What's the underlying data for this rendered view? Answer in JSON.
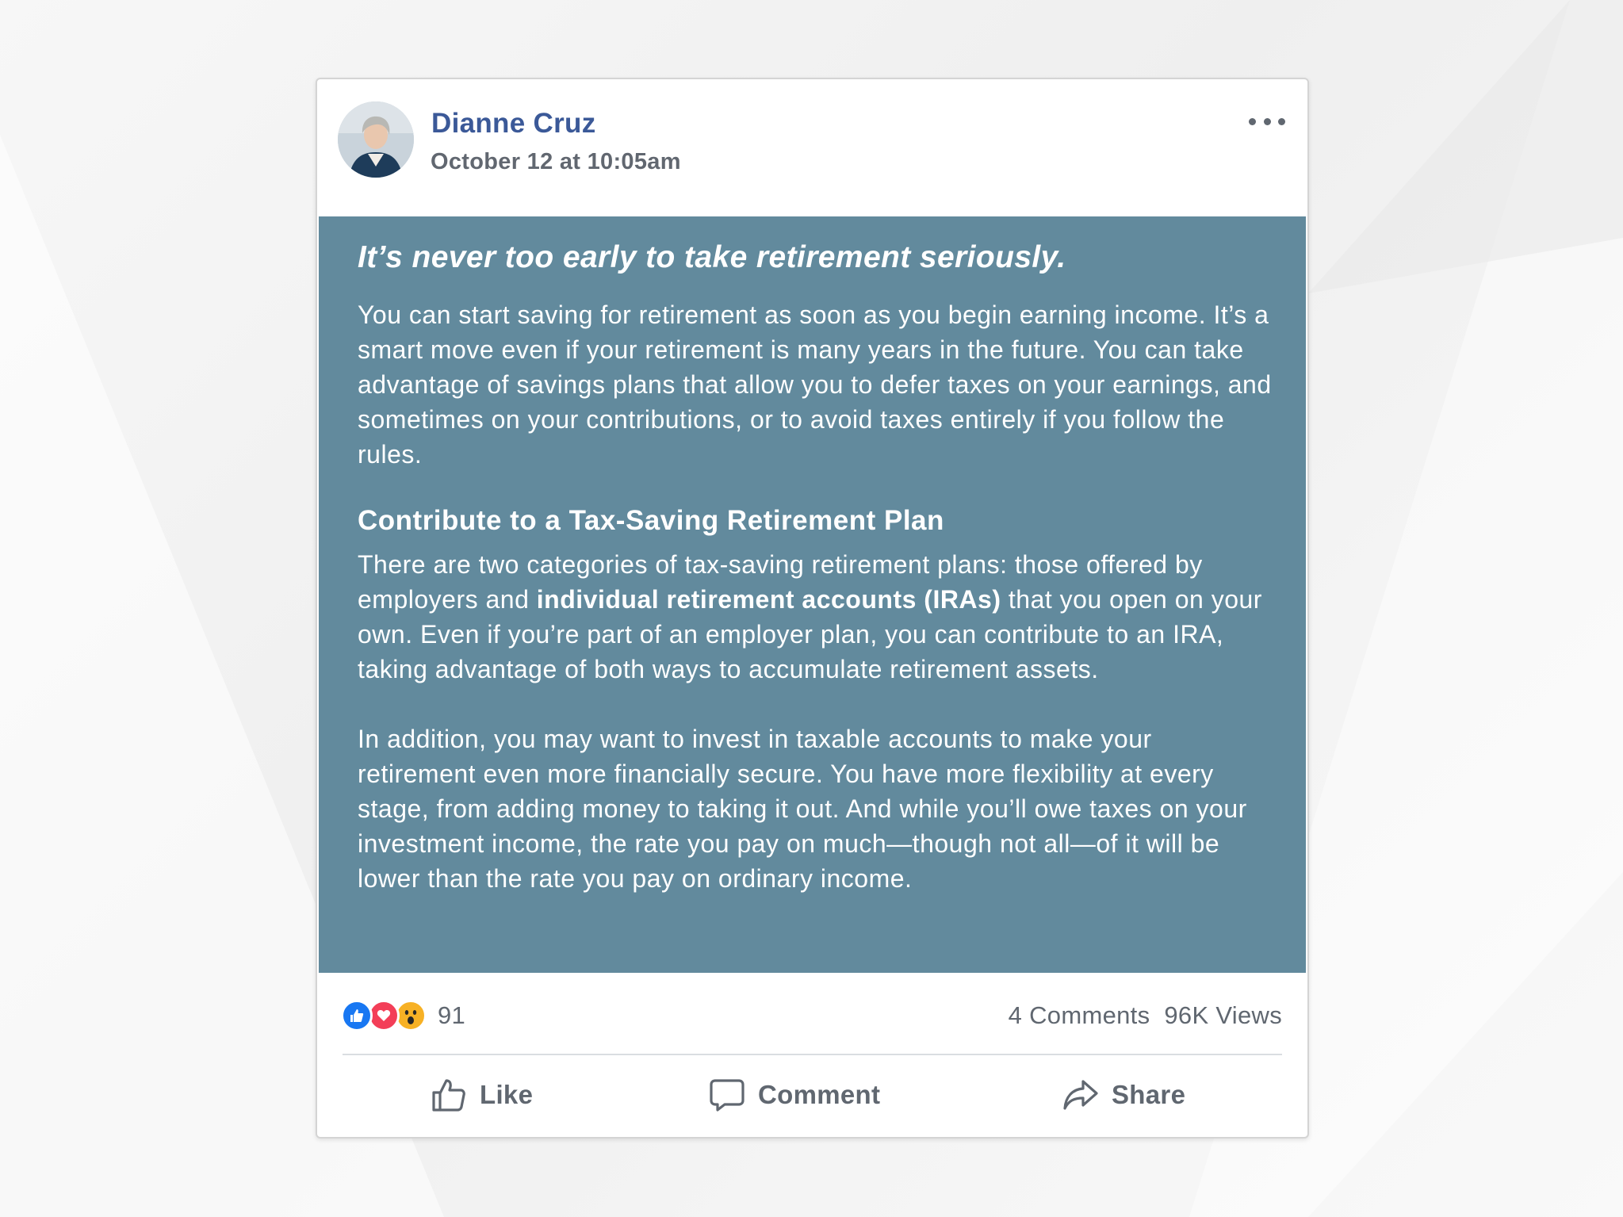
{
  "post": {
    "author": "Dianne Cruz",
    "timestamp": "October 12 at 10:05am",
    "headline": "It’s never too early to take retirement seriously.",
    "paragraph1": "You can start saving for retirement as soon as you begin earning income. It’s a smart move even if your retirement is many years in the future. You can take advantage of savings plans that allow you to defer taxes on your earnings, and sometimes on your contributions, or to avoid taxes entirely if you follow the rules.",
    "subheading": "Contribute to a Tax-Saving Retirement Plan",
    "paragraph2_before": "There are two categories of tax-saving retirement plans: those offered by employers and ",
    "paragraph2_bold": "individual retirement accounts (IRAs)",
    "paragraph2_after": " that you open on your own. Even if you’re part of an employer plan, you can contribute to an IRA, taking advantage of both ways to accumulate retirement assets.",
    "paragraph3": "In addition, you may want to invest in taxable accounts to make your retirement even more financially secure. You have more flexibility at every stage, from adding money to taking it out. And while you’ll owe taxes on your investment income, the rate you pay on much—though not all—of it will be lower than the rate you pay on ordinary income."
  },
  "stats": {
    "reactions": [
      "like-icon",
      "love-icon",
      "wow-icon"
    ],
    "reaction_count": "91",
    "comments": "4 Comments",
    "views": "96K Views"
  },
  "actions": {
    "like_label": "Like",
    "comment_label": "Comment",
    "share_label": "Share"
  },
  "colors": {
    "name": "#3b5998",
    "content_bg": "#628a9d",
    "like": "#1877f2",
    "love": "#f33e58",
    "wow": "#f7b125",
    "muted": "#606770"
  }
}
